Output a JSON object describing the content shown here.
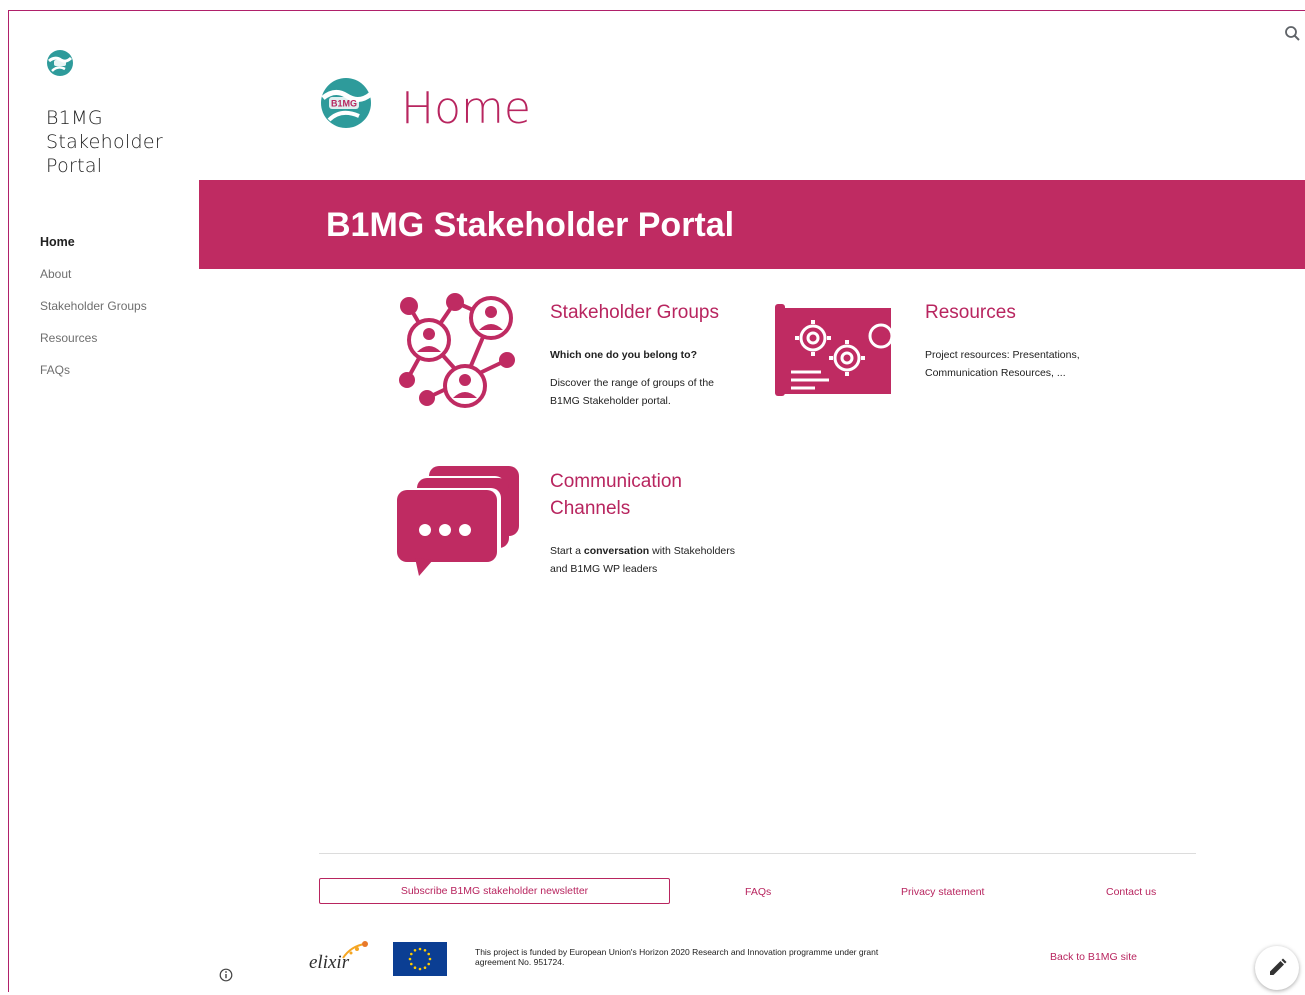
{
  "site": {
    "name": "B1MG Stakeholder Portal"
  },
  "nav": {
    "items": [
      {
        "label": "Home"
      },
      {
        "label": "About"
      },
      {
        "label": "Stakeholder Groups"
      },
      {
        "label": "Resources"
      },
      {
        "label": "FAQs"
      }
    ]
  },
  "page": {
    "title": "Home",
    "logo_text": "B1MG"
  },
  "banner": {
    "heading": "B1MG Stakeholder Portal"
  },
  "cards": [
    {
      "title": "Stakeholder Groups",
      "subtitle": "Which one do you belong to?",
      "text": "Discover the range of groups of the B1MG Stakeholder portal."
    },
    {
      "title": "Resources",
      "text": "Project resources: Presentations, Communication Resources, ..."
    },
    {
      "title": "Communication Channels",
      "text_before": "Start a ",
      "text_bold": "conversation",
      "text_after": " with Stakeholders and B1MG WP leaders"
    }
  ],
  "footer": {
    "subscribe_label": "Subscribe B1MG stakeholder newsletter",
    "links": [
      "FAQs",
      "Privacy statement",
      "Contact us"
    ],
    "funding_text": "This project is funded by European Union's Horizon 2020 Research and Innovation programme under grant agreement No. 951724.",
    "elixir_logo_text": "elixir",
    "back_link": "Back to B1MG site"
  },
  "colors": {
    "accent": "#b8255f",
    "banner": "#bf2b62",
    "logo_teal": "#2e9b9b",
    "eu_blue": "#0b3e93"
  },
  "icons": {
    "search": "search-icon",
    "network": "network-people-icon",
    "resources": "gears-board-icon",
    "chat": "chat-bubbles-icon",
    "info": "info-icon",
    "edit": "pencil-icon"
  }
}
